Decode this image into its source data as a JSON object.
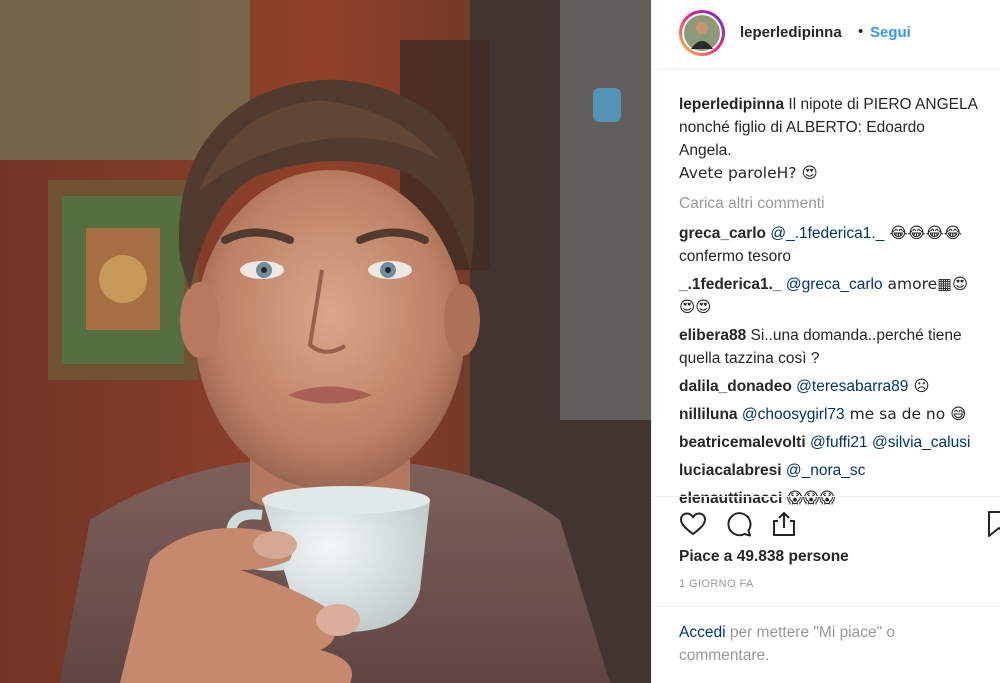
{
  "post": {
    "author": "leperledipinna",
    "separator": "•",
    "follow_label": "Segui"
  },
  "caption": {
    "username": "leperledipinna",
    "text": "Il nipote di PIERO ANGELA nonché figlio di ALBERTO: Edoardo Angela.",
    "text2": "Avete paroleH? 😍"
  },
  "load_more": "Carica altri commenti",
  "comments": [
    {
      "username": "greca_carlo",
      "mention": "@_.1federica1._",
      "text": " 😂😂😂😂",
      "line2": "confermo tesoro"
    },
    {
      "username": "_.1federica1._",
      "mention": "@greca_carlo",
      "text": " amore▦😍",
      "line2": "😍😍"
    },
    {
      "username": "elibera88",
      "mention": "",
      "text": "Si..una domanda..perché tiene",
      "line2": "quella tazzina così ?"
    },
    {
      "username": "dalila_donadeo",
      "mention": "@teresabarra89",
      "text": " ☹"
    },
    {
      "username": "nilliluna",
      "mention": "@choosygirl73",
      "text": " me sa de no 😅"
    },
    {
      "username": "beatricemalevolti",
      "mention": "@fuffi21 @silvia_calusi",
      "text": ""
    },
    {
      "username": "luciacalabresi",
      "mention": "@_nora_sc",
      "text": ""
    },
    {
      "username": "elenauttinacci",
      "mention": "",
      "text": "😱😱😱"
    }
  ],
  "actions": {
    "like_icon": "heart-icon",
    "comment_icon": "comment-icon",
    "share_icon": "share-icon",
    "save_icon": "bookmark-icon"
  },
  "likes": {
    "prefix": "Piace a",
    "count": "49.838",
    "suffix": "persone"
  },
  "timestamp": "1 GIORNO FA",
  "login": {
    "link": "Accedi",
    "text": " per mettere \"Mi piace\" o commentare."
  },
  "colors": {
    "link_blue": "#3897f0",
    "mention_dark": "#003569",
    "muted": "#999999"
  }
}
